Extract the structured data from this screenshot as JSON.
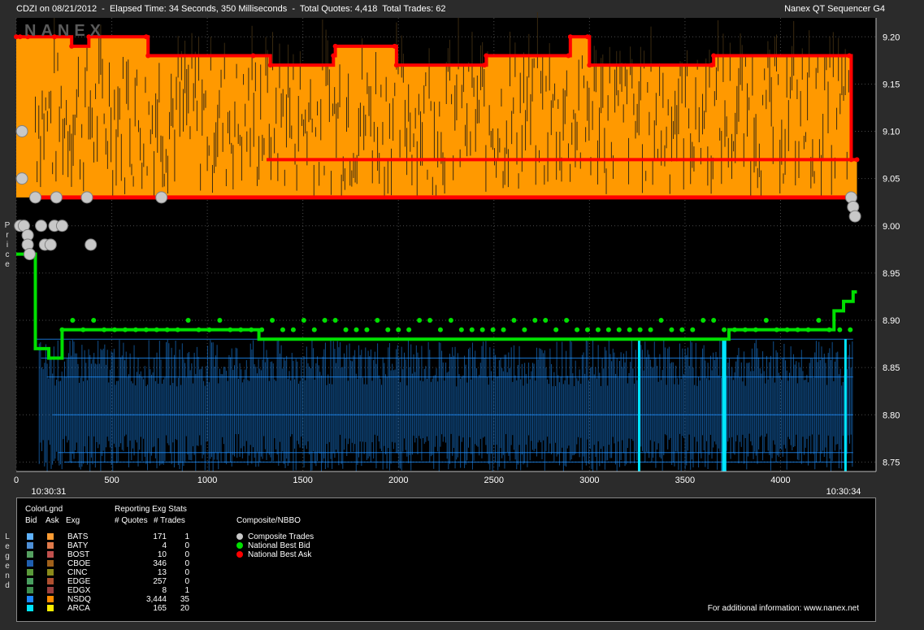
{
  "header": {
    "left": "CDZI on 08/21/2012  -  Elapsed Time: 34 Seconds, 350 Milliseconds  -  Total Quotes: 4,418  Total Trades: 62",
    "right": "Nanex QT Sequencer G4"
  },
  "watermark": "NANEX",
  "ylabel": "Price",
  "colors": {
    "ask_fill": "#ff9900",
    "best_ask": "#ff0000",
    "best_bid": "#00e000",
    "bid_lines": "#1e90ff",
    "arca_bid": "#00e5ff",
    "trade": "#c8c8c8",
    "plot_bg": "#000000"
  },
  "chart_data": {
    "type": "line",
    "title": "CDZI on 08/21/2012",
    "xlabel": "",
    "ylabel": "Price",
    "xlim": [
      0,
      4500
    ],
    "ylim": [
      8.74,
      9.22
    ],
    "x_ticks": [
      0,
      500,
      1000,
      1500,
      2000,
      2500,
      3000,
      3500,
      4000
    ],
    "y_ticks": [
      8.75,
      8.8,
      8.85,
      8.9,
      8.95,
      9.0,
      9.05,
      9.1,
      9.15,
      9.2
    ],
    "time_labels": [
      {
        "x": 170,
        "label": "10:30:31"
      },
      {
        "x": 4330,
        "label": "10:30:34"
      }
    ],
    "series": [
      {
        "name": "National Best Ask",
        "points": [
          [
            0,
            9.2
          ],
          [
            20,
            9.2
          ],
          [
            60,
            9.2
          ],
          [
            200,
            9.2
          ],
          [
            290,
            9.19
          ],
          [
            380,
            9.2
          ],
          [
            680,
            9.2
          ],
          [
            690,
            9.18
          ],
          [
            1240,
            9.18
          ],
          [
            1330,
            9.17
          ],
          [
            1660,
            9.18
          ],
          [
            1670,
            9.19
          ],
          [
            1980,
            9.19
          ],
          [
            1990,
            9.17
          ],
          [
            2450,
            9.17
          ],
          [
            2460,
            9.18
          ],
          [
            2890,
            9.18
          ],
          [
            2900,
            9.2
          ],
          [
            2990,
            9.2
          ],
          [
            3000,
            9.17
          ],
          [
            3640,
            9.17
          ],
          [
            3650,
            9.18
          ],
          [
            4360,
            9.18
          ],
          [
            4370,
            9.07
          ],
          [
            4400,
            9.07
          ]
        ]
      },
      {
        "name": "National Best Bid",
        "points": [
          [
            0,
            8.97
          ],
          [
            90,
            8.97
          ],
          [
            100,
            8.87
          ],
          [
            170,
            8.86
          ],
          [
            240,
            8.89
          ],
          [
            1260,
            8.89
          ],
          [
            1270,
            8.88
          ],
          [
            3720,
            8.88
          ],
          [
            3730,
            8.89
          ],
          [
            4260,
            8.89
          ],
          [
            4280,
            8.91
          ],
          [
            4330,
            8.92
          ],
          [
            4380,
            8.93
          ],
          [
            4400,
            8.93
          ]
        ]
      },
      {
        "name": "Composite Trades",
        "points": [
          [
            20,
            9.0
          ],
          [
            30,
            9.1
          ],
          [
            30,
            9.05
          ],
          [
            40,
            9.0
          ],
          [
            60,
            8.99
          ],
          [
            60,
            8.98
          ],
          [
            70,
            8.97
          ],
          [
            100,
            9.03
          ],
          [
            130,
            9.0
          ],
          [
            150,
            8.98
          ],
          [
            180,
            8.98
          ],
          [
            200,
            9.0
          ],
          [
            210,
            9.03
          ],
          [
            240,
            9.0
          ],
          [
            370,
            9.03
          ],
          [
            390,
            8.98
          ],
          [
            760,
            9.03
          ],
          [
            4370,
            9.03
          ],
          [
            4380,
            9.02
          ],
          [
            4390,
            9.01
          ]
        ]
      }
    ]
  },
  "legend": {
    "vlabel": "Legend",
    "title_colorlgnd": "ColorLgnd",
    "title_stats": "Reporting Exg Stats",
    "title_composite": "Composite/NBBO",
    "col_bid": "Bid",
    "col_ask": "Ask",
    "col_exg": "Exg",
    "col_quotes": "# Quotes",
    "col_trades": "# Trades",
    "exchanges": [
      {
        "name": "BATS",
        "quotes": "171",
        "trades": "1",
        "bid": "#5fb2ff",
        "ask": "#ff9c33"
      },
      {
        "name": "BATY",
        "quotes": "4",
        "trades": "0",
        "bid": "#4d8fd6",
        "ask": "#e07a4a"
      },
      {
        "name": "BOST",
        "quotes": "10",
        "trades": "0",
        "bid": "#55a060",
        "ask": "#c0504d"
      },
      {
        "name": "CBOE",
        "quotes": "346",
        "trades": "0",
        "bid": "#1f5fb0",
        "ask": "#a0601a"
      },
      {
        "name": "CINC",
        "quotes": "13",
        "trades": "0",
        "bid": "#5a9a3a",
        "ask": "#8a8a1a"
      },
      {
        "name": "EDGE",
        "quotes": "257",
        "trades": "0",
        "bid": "#4aa060",
        "ask": "#b05030"
      },
      {
        "name": "EDGX",
        "quotes": "8",
        "trades": "1",
        "bid": "#3f8f4f",
        "ask": "#9c4040"
      },
      {
        "name": "NSDQ",
        "quotes": "3,444",
        "trades": "35",
        "bid": "#1e88ff",
        "ask": "#ff8c00"
      },
      {
        "name": "ARCA",
        "quotes": "165",
        "trades": "20",
        "bid": "#00e5ff",
        "ask": "#ffee00"
      }
    ],
    "composite": [
      {
        "label": "Composite Trades",
        "color": "#c8c8c8"
      },
      {
        "label": "National Best Bid",
        "color": "#00e000"
      },
      {
        "label": "National Best Ask",
        "color": "#ff0000"
      }
    ],
    "info": "For additional information: www.nanex.net"
  }
}
